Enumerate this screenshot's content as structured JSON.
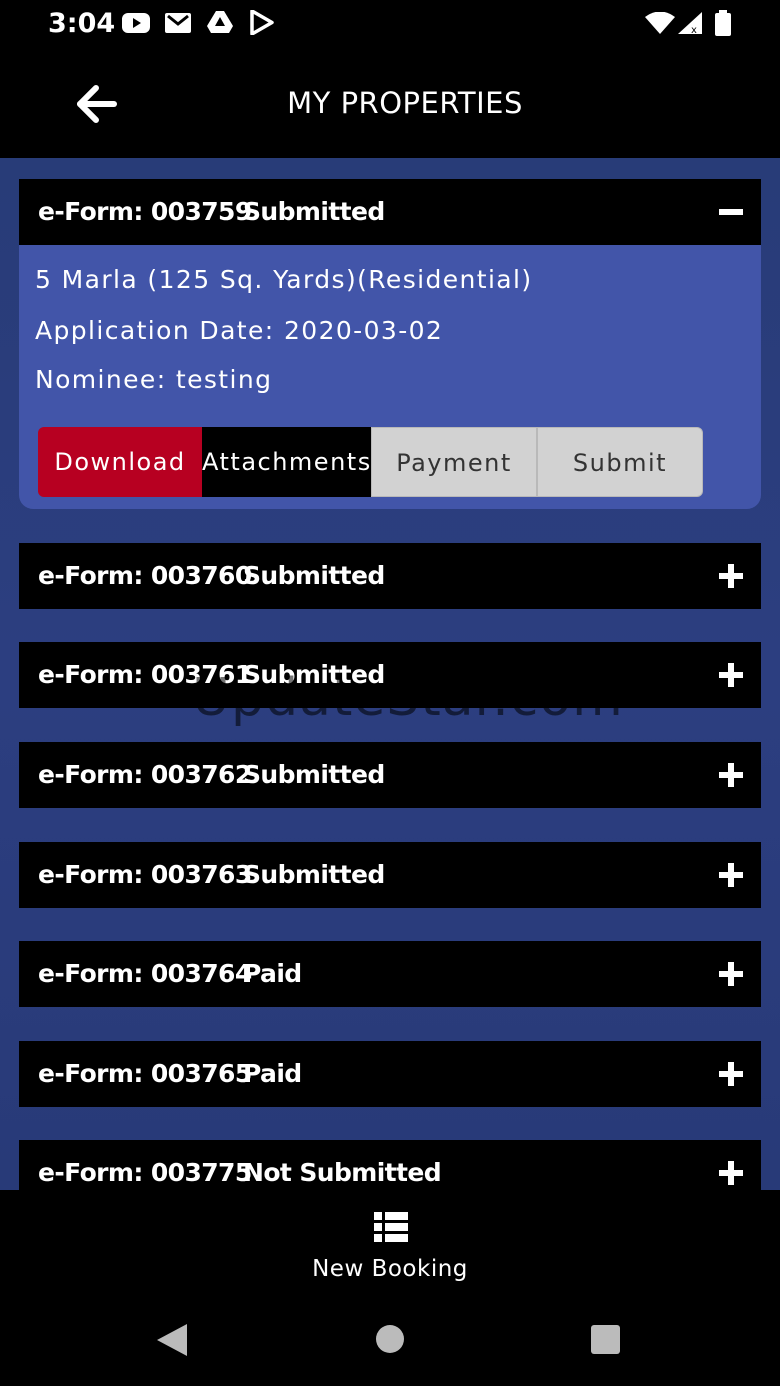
{
  "status_bar": {
    "time": "3:04"
  },
  "header": {
    "title": "MY PROPERTIES"
  },
  "expanded": {
    "form": "e-Form: 003759",
    "status": "Submitted",
    "size": "5 Marla (125 Sq. Yards)(Residential)",
    "application_date": "Application Date: 2020-03-02",
    "nominee": "Nominee: testing",
    "buttons": {
      "download": "Download",
      "attachments": "Attachments",
      "payment": "Payment",
      "submit": "Submit"
    }
  },
  "rows": [
    {
      "form": "e-Form: 003760",
      "status": "Submitted"
    },
    {
      "form": "e-Form: 003761",
      "status": "Submitted"
    },
    {
      "form": "e-Form: 003762",
      "status": "Submitted"
    },
    {
      "form": "e-Form: 003763",
      "status": "Submitted"
    },
    {
      "form": "e-Form: 003764",
      "status": "Paid"
    },
    {
      "form": "e-Form: 003765",
      "status": "Paid"
    },
    {
      "form": "e-Form: 003775",
      "status": "Not Submitted"
    }
  ],
  "watermark": "UpdateStar.com",
  "bottom": {
    "new_booking": "New Booking"
  },
  "colors": {
    "accent_red": "#b70021",
    "card_blue": "#4255a9",
    "list_bg": "#2c3e80"
  }
}
